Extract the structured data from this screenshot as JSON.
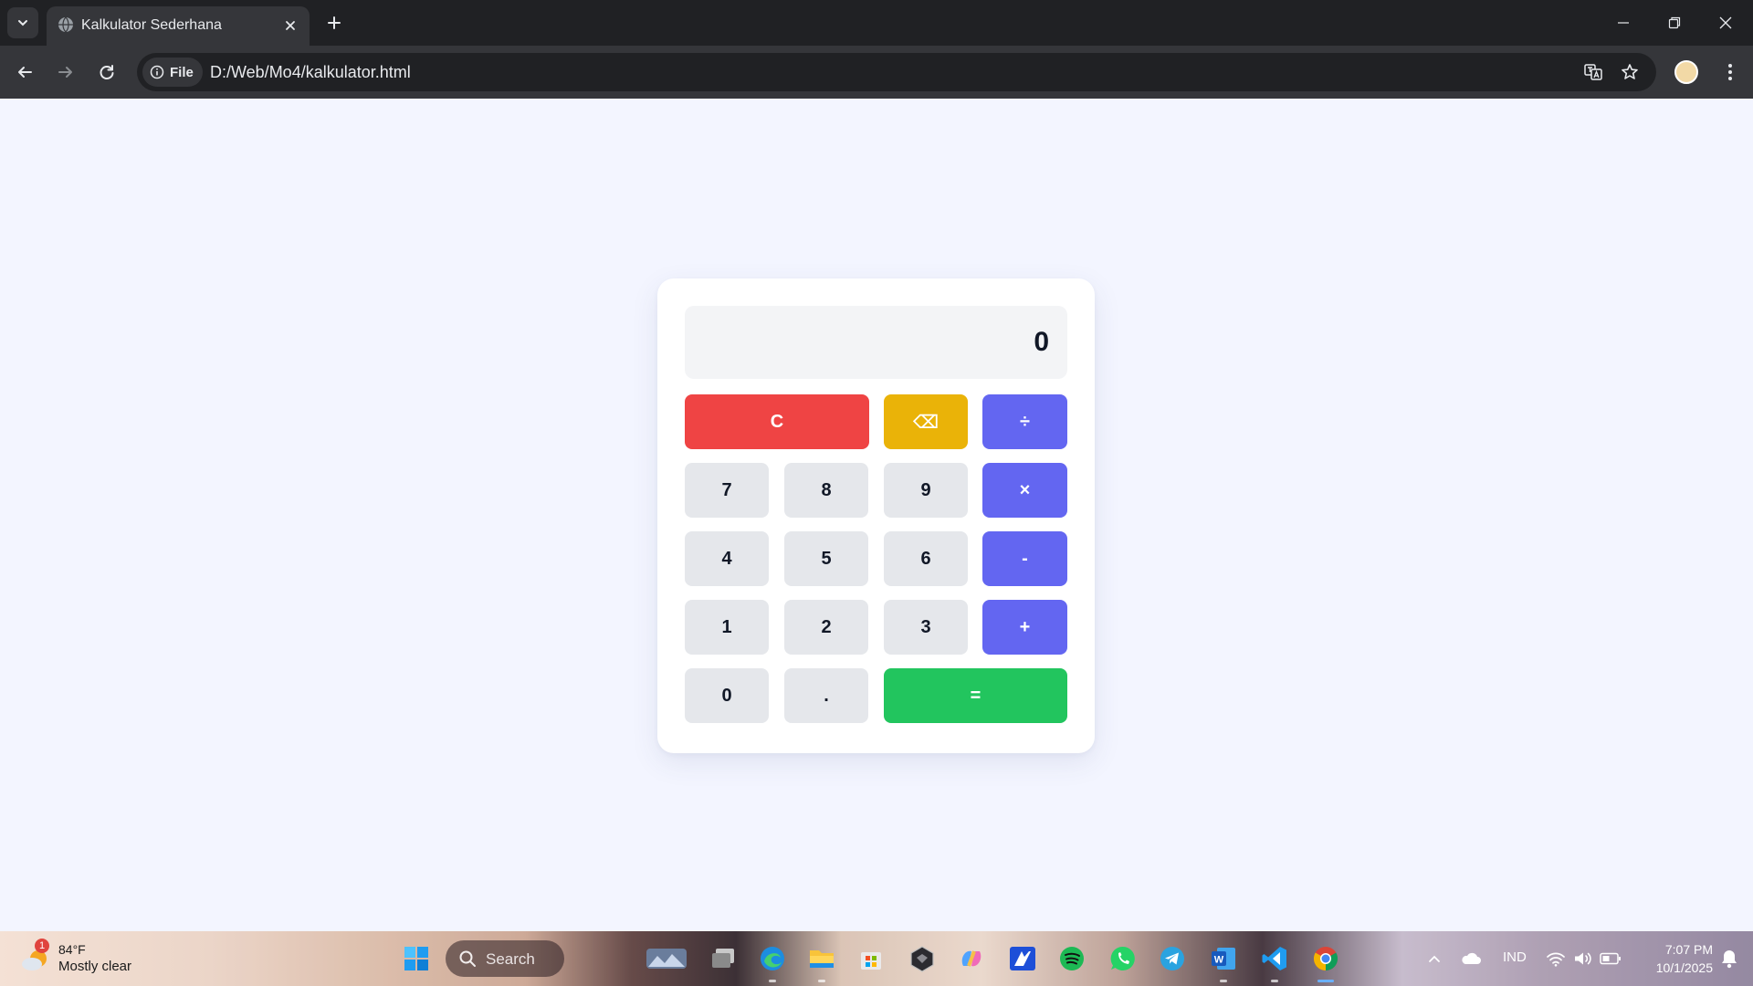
{
  "browser": {
    "tab_title": "Kalkulator Sederhana",
    "site_chip_label": "File",
    "url": "D:/Web/Mo4/kalkulator.html"
  },
  "calculator": {
    "display_value": "0",
    "keys": {
      "clear": "C",
      "backspace": "⌫",
      "divide": "÷",
      "seven": "7",
      "eight": "8",
      "nine": "9",
      "multiply": "×",
      "four": "4",
      "five": "5",
      "six": "6",
      "subtract": "-",
      "one": "1",
      "two": "2",
      "three": "3",
      "add": "+",
      "zero": "0",
      "decimal": ".",
      "equals": "="
    },
    "colors": {
      "number_key": "#e5e7eb",
      "operator_key": "#6366f1",
      "clear_key": "#ef4444",
      "backspace_key": "#eab308",
      "equals_key": "#22c55e",
      "display_bg": "#f3f4f6",
      "page_bg": "#f3f5ff"
    }
  },
  "taskbar": {
    "weather_temp": "84°F",
    "weather_desc": "Mostly clear",
    "weather_badge": "1",
    "search_label": "Search",
    "language": "IND",
    "time": "7:07 PM",
    "date": "10/1/2025",
    "apps": [
      "widgets-icon",
      "start-icon",
      "search-icon",
      "gallery-icon",
      "task-view-icon",
      "edge-icon",
      "file-explorer-icon",
      "microsoft-store-icon",
      "app-icon",
      "copilot-icon",
      "app-icon",
      "spotify-icon",
      "whatsapp-icon",
      "telegram-icon",
      "word-icon",
      "vscode-icon",
      "chrome-icon"
    ]
  }
}
